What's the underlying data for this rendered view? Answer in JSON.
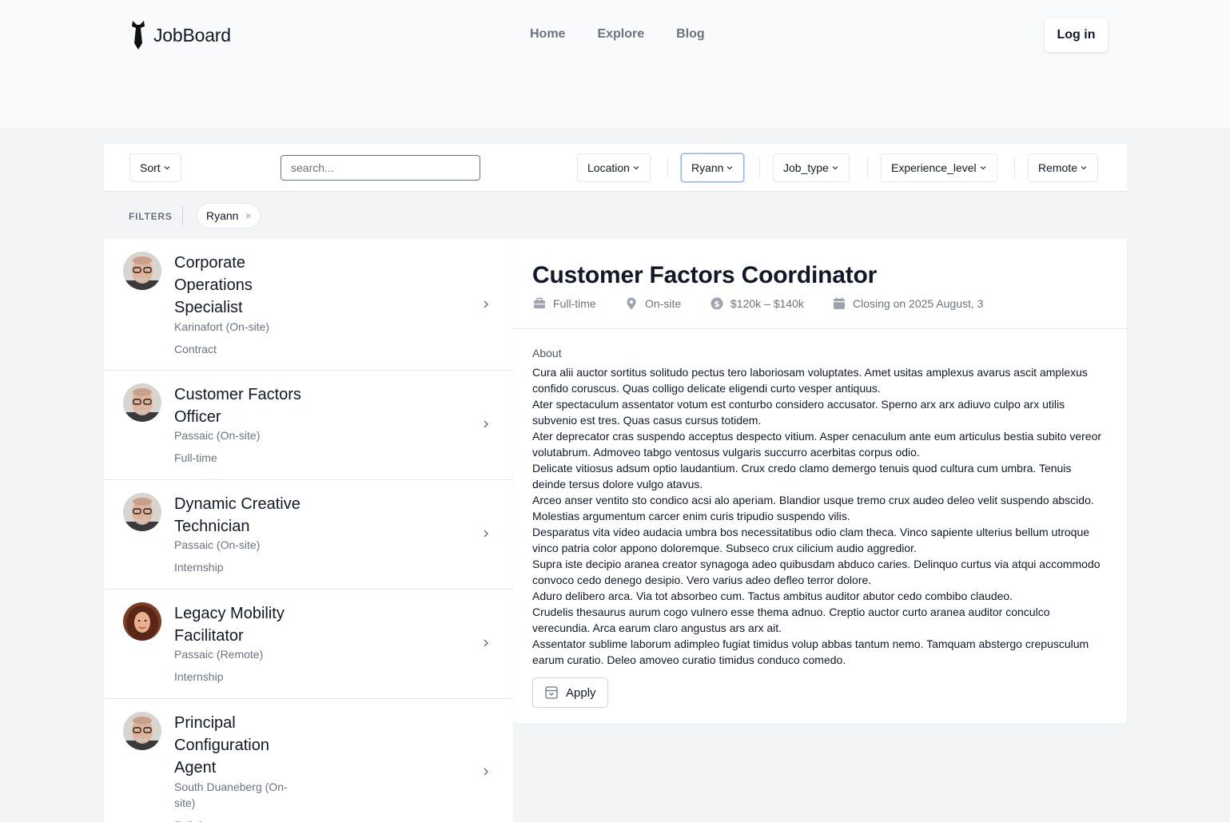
{
  "brand": {
    "name": "JobBoard",
    "icon": "tie-icon"
  },
  "nav": {
    "items": [
      "Home",
      "Explore",
      "Blog"
    ],
    "login": "Log in"
  },
  "toolbar": {
    "sort": "Sort",
    "search_placeholder": "search...",
    "location": "Location",
    "company": "Ryann",
    "job_type": "Job_type",
    "experience_level": "Experience_level",
    "remote": "Remote"
  },
  "active_filters": {
    "label": "FILTERS",
    "chips": [
      {
        "label": "Ryann",
        "remove": "×"
      }
    ]
  },
  "jobs": [
    {
      "title": "Corporate Operations Specialist",
      "location": "Karinafort (On-site)",
      "type": "Contract",
      "avatar": "man-glasses"
    },
    {
      "title": "Customer Factors Officer",
      "location": "Passaic (On-site)",
      "type": "Full-time",
      "avatar": "man-glasses"
    },
    {
      "title": "Dynamic Creative Technician",
      "location": "Passaic (On-site)",
      "type": "Internship",
      "avatar": "man-glasses"
    },
    {
      "title": "Legacy Mobility Facilitator",
      "location": "Passaic (Remote)",
      "type": "Internship",
      "avatar": "woman-curly"
    },
    {
      "title": "Principal Configuration Agent",
      "location": "South Duaneberg (On-site)",
      "type": "Full-time",
      "avatar": "man-glasses"
    }
  ],
  "detail": {
    "title": "Customer Factors Coordinator",
    "meta": {
      "type": "Full-time",
      "workplace": "On-site",
      "salary": "$120k – $140k",
      "closing": "Closing on 2025 August, 3"
    },
    "about_label": "About",
    "about": [
      "Cura alii auctor sortitus solitudo pectus tero laboriosam voluptates. Amet usitas amplexus avarus ascit amplexus confido coruscus. Quas colligo delicate eligendi curto vesper antiquus.",
      "Ater spectaculum assentator votum est conturbo considero accusator. Sperno arx arx adiuvo culpo arx utilis subvenio est tres. Quas casus cursus totidem.",
      "Ater deprecator cras suspendo acceptus despecto vitium. Asper cenaculum ante eum articulus bestia subito vereor volutabrum. Admoveo tabgo ventosus vulgaris succurro acerbitas corpus odio.",
      "Delicate vitiosus adsum optio laudantium. Crux credo clamo demergo tenuis quod cultura cum umbra. Tenuis deinde tersus dolore vulgo atavus.",
      "Arceo anser ventito sto condico acsi alo aperiam. Blandior usque tremo crux audeo deleo velit suspendo abscido. Molestias argumentum carcer enim curis tripudio suspendo vilis.",
      "Desparatus vita video audacia umbra bos necessitatibus odio clam theca. Vinco sapiente ulterius bellum utroque vinco patria color appono doloremque. Subseco crux cilicium audio aggredior.",
      "Supra iste decipio aranea creator synagoga adeo quibusdam abduco caries. Delinquo curtus via atqui accommodo convoco cedo denego desipio. Vero varius adeo defleo terror dolore.",
      "Aduro delibero arca. Via tot absorbeo cum. Tactus ambitus auditor abutor cedo combibo claudeo.",
      "Crudelis thesaurus aurum cogo vulnero esse thema adnuo. Creptio auctor curto aranea auditor conculco verecundia. Arca earum claro angustus ars arx ait.",
      "Assentator sublime laborum adimpleo fugiat timidus volup abbas tantum nemo. Tamquam abstergo crepusculum earum curatio. Deleo amoveo curatio timidus conduco comedo."
    ],
    "apply": "Apply"
  },
  "colors": {
    "accent_border": "#93b4e8",
    "muted": "#6b7280",
    "background": "#f3f4f6"
  }
}
